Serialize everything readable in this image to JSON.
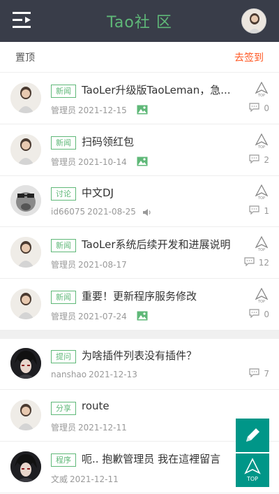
{
  "header": {
    "logo_text": "Tao社 区"
  },
  "subbar": {
    "top_label": "置顶",
    "signin_label": "去签到"
  },
  "pinned_posts": [
    {
      "tag": "新闻",
      "title": "TaoLer升级版TaoLeman，急...",
      "author": "管理员",
      "date": "2021-12-15",
      "comments": "0",
      "media": "image"
    },
    {
      "tag": "新闻",
      "title": "扫码领红包",
      "author": "管理员",
      "date": "2021-10-14",
      "comments": "2",
      "media": "image"
    },
    {
      "tag": "讨论",
      "title": "中文DJ",
      "author": "id66075",
      "date": "2021-08-25",
      "comments": "1",
      "media": "audio"
    },
    {
      "tag": "新闻",
      "title": "TaoLer系统后续开发和进展说明",
      "author": "管理员",
      "date": "2021-08-17",
      "comments": "12",
      "media": "none"
    },
    {
      "tag": "新闻",
      "title": "重要！更新程序服务修改",
      "author": "管理员",
      "date": "2021-07-24",
      "comments": "0",
      "media": "image"
    }
  ],
  "posts": [
    {
      "tag": "提问",
      "title": "为啥插件列表没有插件？",
      "author": "nanshao",
      "date": "2021-12-13",
      "comments": "7"
    },
    {
      "tag": "分享",
      "title": "route",
      "author": "管理员",
      "date": "2021-12-11",
      "comments": ""
    },
    {
      "tag": "程序",
      "title": "呃.. 抱歉管理员 我在這裡留言",
      "author": "文威",
      "date": "2021-12-11",
      "comments": ""
    }
  ],
  "float_buttons": {
    "top_label": "TOP"
  },
  "colors": {
    "header_bg": "#393d49",
    "accent_green": "#5fb878",
    "float_bg": "#009688",
    "signin_orange": "#ff5722"
  }
}
